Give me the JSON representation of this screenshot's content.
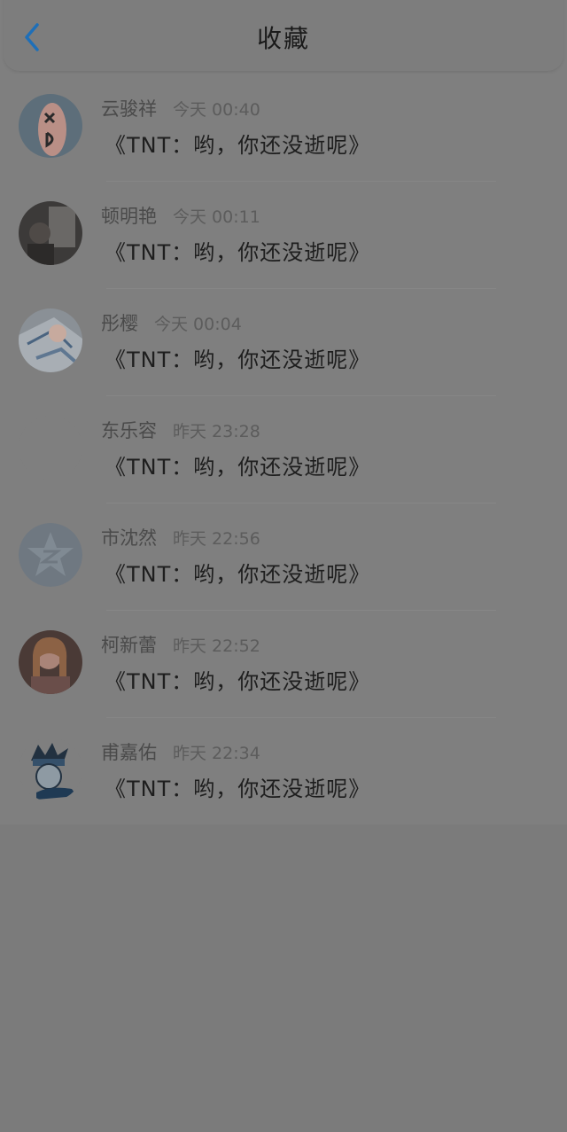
{
  "header": {
    "title": "收藏",
    "back_icon": "chevron-left-icon",
    "accent": "#1e6fb8"
  },
  "items": [
    {
      "name": "云骏祥",
      "time": "今天 00:40",
      "message": "《TNT：哟，你还没逝呢》",
      "avatar": "avatar-xd"
    },
    {
      "name": "顿明艳",
      "time": "今天 00:11",
      "message": "《TNT：哟，你还没逝呢》",
      "avatar": "avatar-dark-room"
    },
    {
      "name": "彤樱",
      "time": "今天 00:04",
      "message": "《TNT：哟，你还没逝呢》",
      "avatar": "avatar-anime-girl"
    },
    {
      "name": "东乐容",
      "time": "昨天 23:28",
      "message": "《TNT：哟，你还没逝呢》",
      "avatar": "avatar-empty"
    },
    {
      "name": "市沈然",
      "time": "昨天 22:56",
      "message": "《TNT：哟，你还没逝呢》",
      "avatar": "avatar-qq-star"
    },
    {
      "name": "柯新蕾",
      "time": "昨天 22:52",
      "message": "《TNT：哟，你还没逝呢》",
      "avatar": "avatar-girl-photo"
    },
    {
      "name": "甫嘉佑",
      "time": "昨天 22:34",
      "message": "《TNT：哟，你还没逝呢》",
      "avatar": "avatar-ninja"
    }
  ]
}
